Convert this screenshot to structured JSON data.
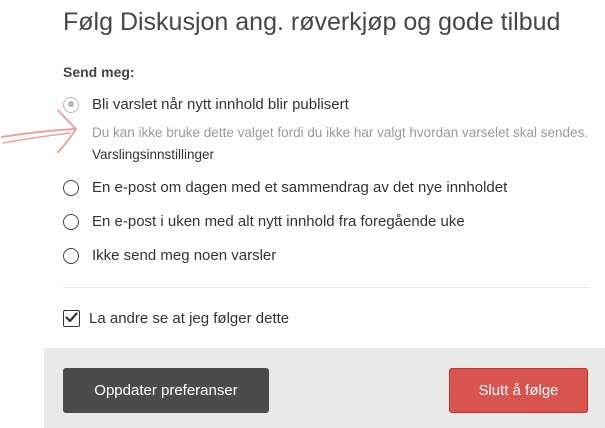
{
  "title": "Følg Diskusjon ang. røverkjøp og gode tilbud",
  "section_label": "Send meg:",
  "options": [
    {
      "label": "Bli varslet når nytt innhold blir publisert",
      "disabled": true
    },
    {
      "label": "En e-post om dagen med et sammendrag av det nye innholdet",
      "disabled": false
    },
    {
      "label": "En e-post i uken med alt nytt innhold fra foregående uke",
      "disabled": false
    },
    {
      "label": "Ikke send meg noen varsler",
      "disabled": false
    }
  ],
  "help": {
    "text": "Du kan ikke bruke dette valget fordi du ikke har valgt hvordan varselet skal sendes.",
    "link": "Varslingsinnstillinger"
  },
  "checkbox": {
    "label": "La andre se at jeg følger dette",
    "checked": true
  },
  "buttons": {
    "update": "Oppdater preferanser",
    "unfollow": "Slutt å følge"
  },
  "colors": {
    "unfollow_button": "#d9534f",
    "update_button": "#4b4b4b",
    "annotation_arrow": "#f0a0a0",
    "footer_bg": "#e9e9e9"
  }
}
